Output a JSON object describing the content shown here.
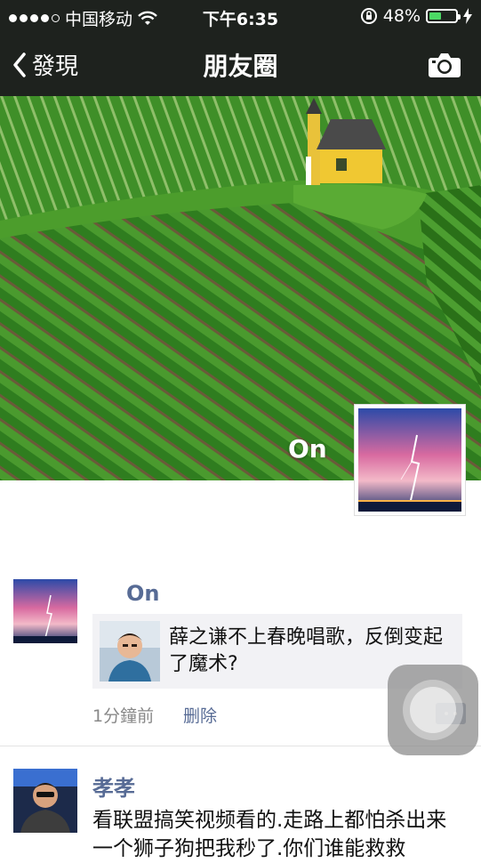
{
  "status_bar": {
    "carrier": "中国移动",
    "time": "下午6:35",
    "battery_percent": "48%",
    "battery_level": 0.48,
    "signal_dots_filled": 4,
    "signal_dots_total": 5,
    "icons": [
      "signal-dots-icon",
      "wifi-icon",
      "rotation-lock-icon",
      "battery-icon",
      "charging-bolt-icon"
    ]
  },
  "nav": {
    "back_label": "發現",
    "title": "朋友圈",
    "camera_icon": "camera-icon"
  },
  "cover": {
    "user_name": "On"
  },
  "posts": [
    {
      "name": "On",
      "share_title": "薛之谦不上春晚唱歌，反倒变起了魔术?",
      "time": "1分鐘前",
      "delete_label": "删除"
    },
    {
      "name": "孝孝",
      "text": "看联盟搞笑视频看的.走路上都怕杀出来一个狮子狗把我秒了.你们谁能救救"
    }
  ],
  "colors": {
    "nav_bg": "#1e221e",
    "link_blue": "#576b95",
    "battery_green": "#4cd964",
    "share_bg": "#f2f2f5"
  }
}
